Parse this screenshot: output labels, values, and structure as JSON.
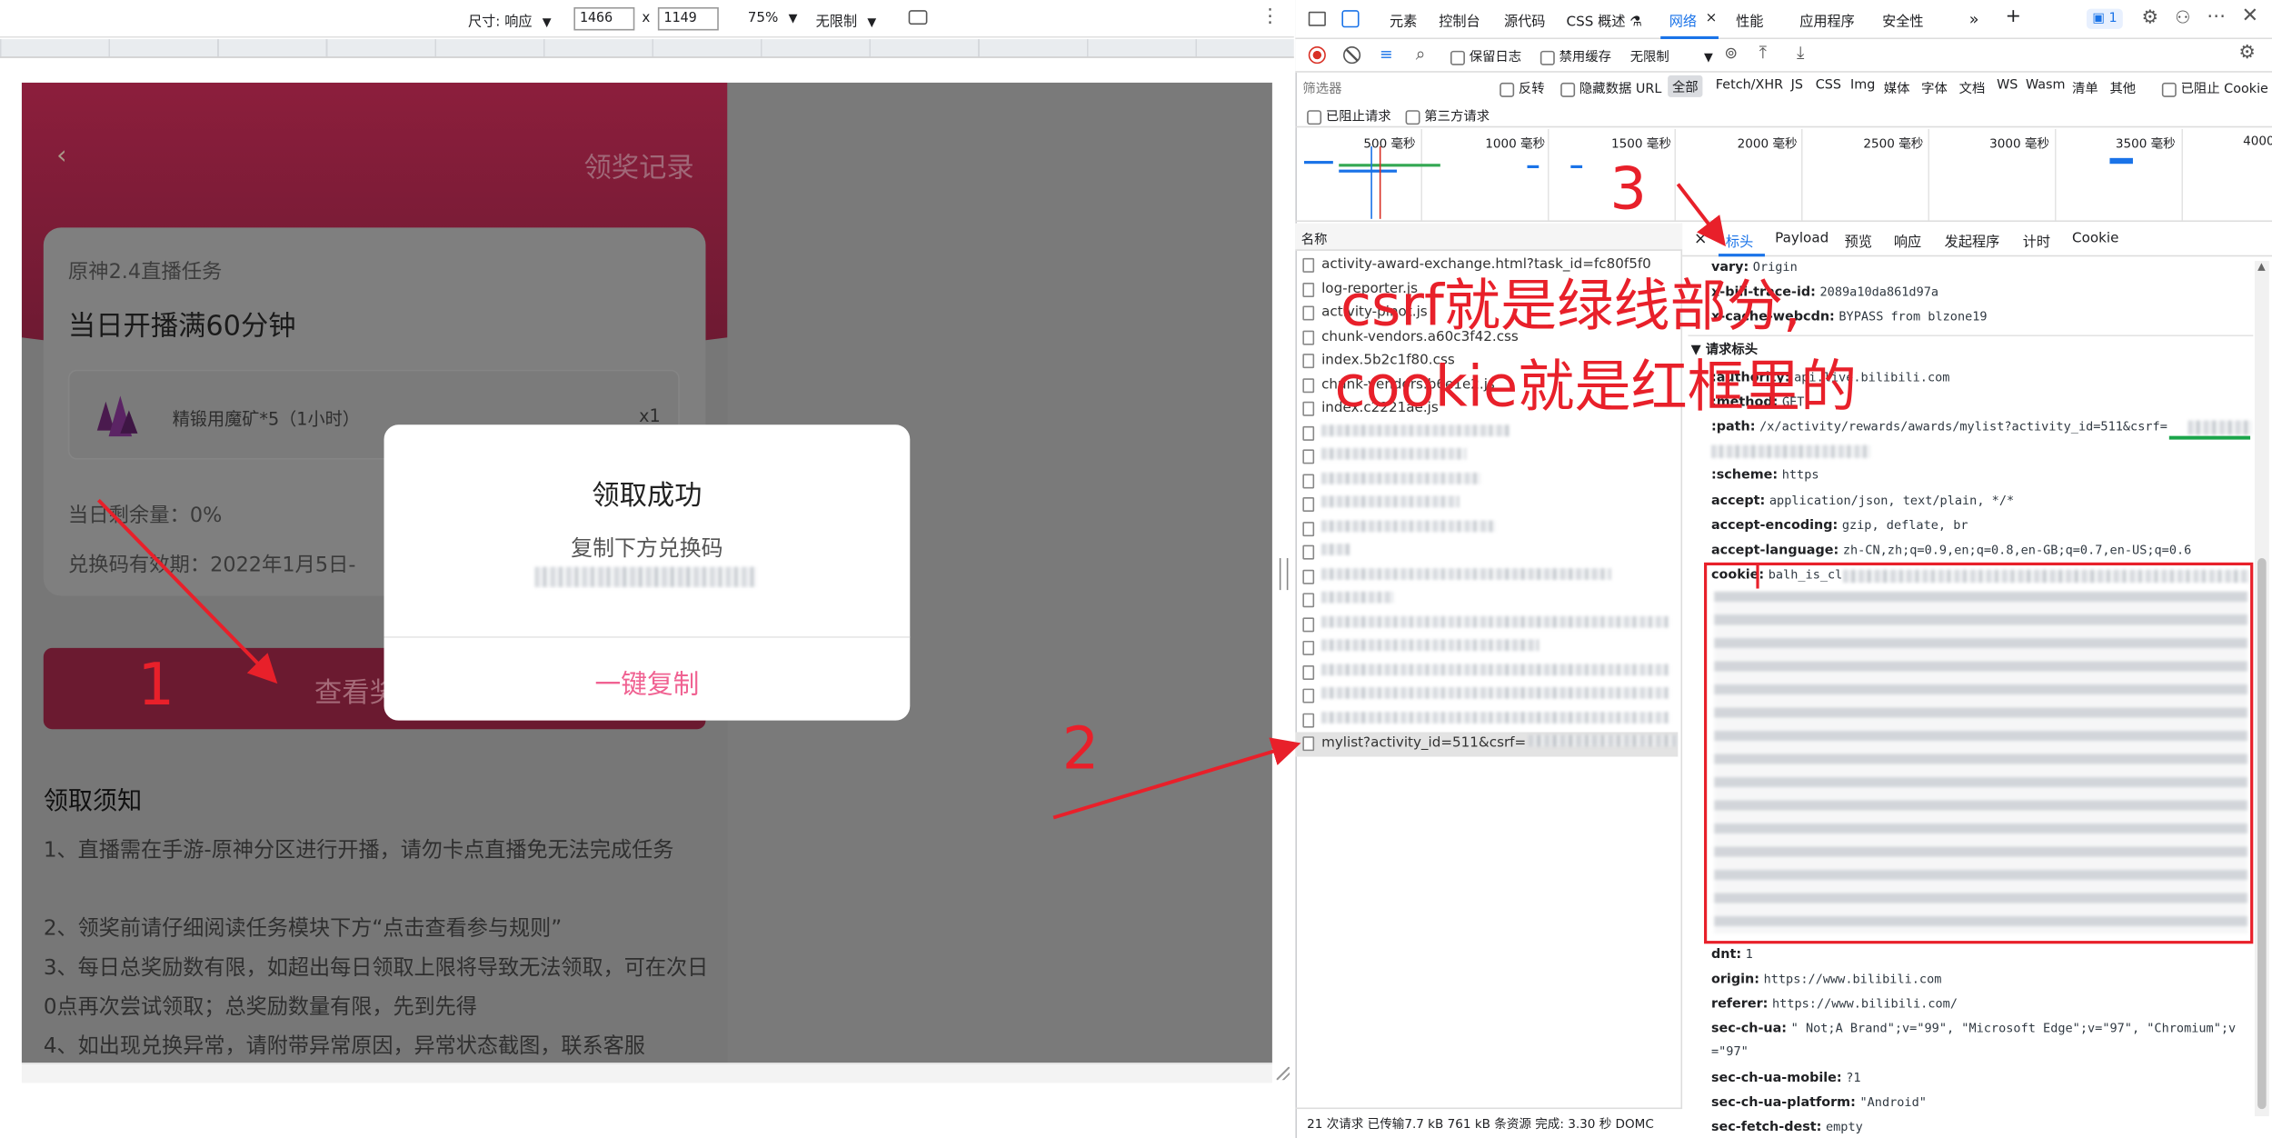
{
  "device_toolbar": {
    "size_label": "尺寸: 响应",
    "width": "1466",
    "times": "x",
    "height": "1149",
    "zoom": "75%",
    "throttle": "无限制",
    "more": "⋮"
  },
  "app": {
    "back": "‹",
    "title": "领奖记录",
    "task_name": "原神2.4直播任务",
    "task_title": "当日开播满60分钟",
    "reward_name": "精锻用魔矿*5（1小时）",
    "reward_count": "x1",
    "remaining": "当日剩余量：0%",
    "validity": "兑换码有效期：2022年1月5日-",
    "view_button": "查看奖",
    "notice_title": "领取须知",
    "notices": [
      "1、直播需在手游-原神分区进行开播，请勿卡点直播免无法完成任务",
      "2、领奖前请仔细阅读任务模块下方“点击查看参与规则”",
      "3、每日总奖励数有限，如超出每日领取上限将导致无法领取，可在次日0点再次尝试领取；总奖励数量有限，先到先得",
      "4、如出现兑换异常，请附带异常原因，异常状态截图，联系客服"
    ]
  },
  "modal": {
    "title": "领取成功",
    "subtitle": "复制下方兑换码",
    "button": "一键复制"
  },
  "devtools": {
    "tabs": [
      "元素",
      "控制台",
      "源代码",
      "CSS 概述 ⚗",
      "网络",
      "性能",
      "应用程序",
      "安全性"
    ],
    "active_tab": "网络",
    "issues_badge": "1",
    "toolbar": {
      "preserve_log": "保留日志",
      "disable_cache": "禁用缓存",
      "throttle": "无限制"
    },
    "filter": {
      "placeholder": "筛选器",
      "invert": "反转",
      "hide_data_urls": "隐藏数据 URL",
      "types": [
        "全部",
        "Fetch/XHR",
        "JS",
        "CSS",
        "Img",
        "媒体",
        "字体",
        "文档",
        "WS",
        "Wasm",
        "清单",
        "其他"
      ],
      "blocked_cookies": "已阻止 Cookie",
      "blocked_requests": "已阻止请求",
      "third_party": "第三方请求"
    },
    "timeline_ticks": [
      "500 毫秒",
      "1000 毫秒",
      "1500 毫秒",
      "2000 毫秒",
      "2500 毫秒",
      "3000 毫秒",
      "3500 毫秒",
      "4000"
    ],
    "name_header": "名称",
    "requests": [
      "activity-award-exchange.html?task_id=fc80f5f0",
      "log-reporter.js",
      "activity-pinot.js",
      "chunk-vendors.a60c3f42.css",
      "index.5b2c1f80.css",
      "chunk-vendors.b6e1e2.js",
      "index.c2221ae.js"
    ],
    "selected_request": "mylist?activity_id=511&csrf=",
    "detail_tabs": [
      "标头",
      "Payload",
      "预览",
      "响应",
      "发起程序",
      "计时",
      "Cookie"
    ],
    "headers_top": [
      {
        "k": "vary:",
        "v": "Origin"
      },
      {
        "k": "x-bili-trace-id:",
        "v": "2089a10da861d97a"
      },
      {
        "k": "x-cache-webcdn:",
        "v": "BYPASS from blzone19"
      }
    ],
    "request_headers_title": "▼ 请求标头",
    "headers_req": [
      {
        "k": ":authority:",
        "v": "api.live.bilibili.com"
      },
      {
        "k": ":method:",
        "v": "GET"
      },
      {
        "k": ":path:",
        "v": "/x/activity/rewards/awards/mylist?activity_id=511&csrf="
      },
      {
        "k": ":scheme:",
        "v": "https"
      },
      {
        "k": "accept:",
        "v": "application/json, text/plain, */*"
      },
      {
        "k": "accept-encoding:",
        "v": "gzip, deflate, br"
      },
      {
        "k": "accept-language:",
        "v": "zh-CN,zh;q=0.9,en;q=0.8,en-GB;q=0.7,en-US;q=0.6"
      },
      {
        "k": "cookie:",
        "v": "balh_is_cl"
      }
    ],
    "headers_bottom": [
      {
        "k": "dnt:",
        "v": "1"
      },
      {
        "k": "origin:",
        "v": "https://www.bilibili.com"
      },
      {
        "k": "referer:",
        "v": "https://www.bilibili.com/"
      },
      {
        "k": "sec-ch-ua:",
        "v": "\" Not;A Brand\";v=\"99\", \"Microsoft Edge\";v=\"97\", \"Chromium\";v"
      },
      {
        "k": "",
        "v": "=\"97\""
      },
      {
        "k": "sec-ch-ua-mobile:",
        "v": "?1"
      },
      {
        "k": "sec-ch-ua-platform:",
        "v": "\"Android\""
      },
      {
        "k": "sec-fetch-dest:",
        "v": "empty"
      }
    ],
    "status_bar": "21 次请求  已传输7.7 kB  761 kB 条资源  完成: 3.30 秒  DOMC"
  },
  "annotations": {
    "label_1": "1",
    "label_2": "2",
    "label_3": "3",
    "text_line1": "csrf就是绿线部分,",
    "text_line2": "cookie就是红框里的"
  },
  "colors": {
    "overlay": "#7a7a7a",
    "banner": "#b3264d",
    "accent_pink": "#f06292",
    "annotation_red": "#e8202a",
    "underline_green": "#1aa54a",
    "devtools_blue": "#1a73e8"
  }
}
